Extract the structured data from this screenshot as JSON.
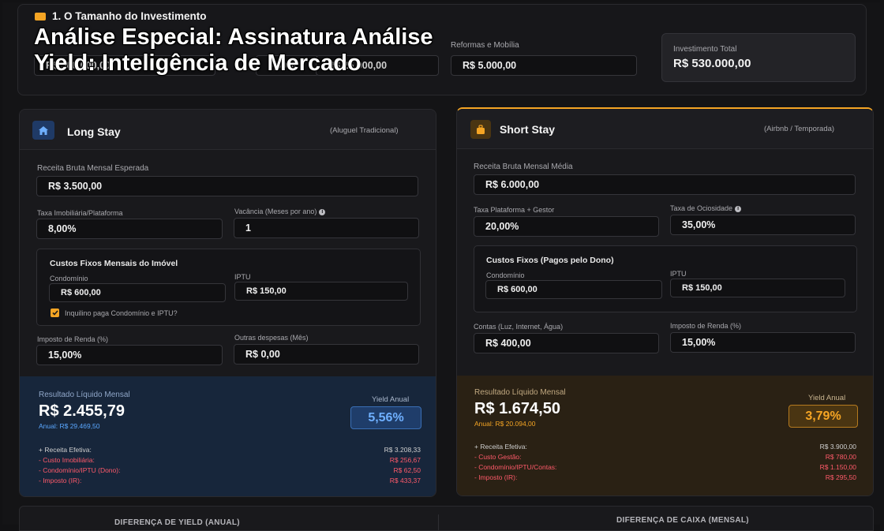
{
  "overlay": {
    "title": "Análise Especial: Assinatura Análise Yield: Inteligência de Mercado"
  },
  "investment": {
    "heading": "1. O Tamanho do Investimento",
    "property_value": "R$ 500.000,00",
    "fee_percent": "5,00%",
    "fee_value": "R$ 25.000,00",
    "reforms_label": "Reformas e Mobília",
    "reforms_value": "R$ 5.000,00",
    "total_label": "Investimento Total",
    "total_value": "R$ 530.000,00"
  },
  "long_stay": {
    "title": "Long Stay",
    "subtitle": "(Aluguel Tradicional)",
    "revenue_label": "Receita Bruta Mensal Esperada",
    "revenue_value": "R$ 3.500,00",
    "fee_label": "Taxa Imobiliária/Plataforma",
    "fee_value": "8,00%",
    "vacancy_label": "Vacância (Meses por ano)",
    "vacancy_value": "1",
    "fixed_costs_title": "Custos Fixos Mensais do Imóvel",
    "condo_label": "Condomínio",
    "condo_value": "R$ 600,00",
    "iptu_label": "IPTU",
    "iptu_value": "R$ 150,00",
    "tenant_pays_label": "Inquilino paga Condomínio e IPTU?",
    "tax_label": "Imposto de Renda (%)",
    "tax_value": "15,00%",
    "other_label": "Outras despesas (Mês)",
    "other_value": "R$ 0,00",
    "result_label": "Resultado Líquido Mensal",
    "result_value": "R$ 2.455,79",
    "annual_text": "Anual: R$ 29.469,50",
    "yield_label": "Yield Anual",
    "yield_value": "5,56%",
    "breakdown": [
      {
        "label": "+ Receita Efetiva:",
        "value": "R$ 3.208,33"
      },
      {
        "label": "- Custo Imobiliária:",
        "value": "R$ 256,67"
      },
      {
        "label": "- Condomínio/IPTU (Dono):",
        "value": "R$ 62,50"
      },
      {
        "label": "- Imposto (IR):",
        "value": "R$ 433,37"
      }
    ]
  },
  "short_stay": {
    "title": "Short Stay",
    "subtitle": "(Airbnb / Temporada)",
    "revenue_label": "Receita Bruta Mensal Média",
    "revenue_value": "R$ 6.000,00",
    "fee_label": "Taxa Plataforma + Gestor",
    "fee_value": "20,00%",
    "idle_label": "Taxa de Ociosidade",
    "idle_value": "35,00%",
    "fixed_costs_title": "Custos Fixos (Pagos pelo Dono)",
    "condo_label": "Condomínio",
    "condo_value": "R$ 600,00",
    "iptu_label": "IPTU",
    "iptu_value": "R$ 150,00",
    "bills_label": "Contas (Luz, Internet, Água)",
    "bills_value": "R$ 400,00",
    "tax_label": "Imposto de Renda (%)",
    "tax_value": "15,00%",
    "result_label": "Resultado Líquido Mensal",
    "result_value": "R$ 1.674,50",
    "annual_text": "Anual: R$ 20.094,00",
    "yield_label": "Yield Anual",
    "yield_value": "3,79%",
    "breakdown": [
      {
        "label": "+ Receita Efetiva:",
        "value": "R$ 3.900,00"
      },
      {
        "label": "- Custo Gestão:",
        "value": "R$ 780,00"
      },
      {
        "label": "- Condomínio/IPTU/Contas:",
        "value": "R$ 1.150,00"
      },
      {
        "label": "- Imposto (IR):",
        "value": "R$ 295,50"
      }
    ]
  },
  "footer": {
    "yield_diff": "DIFERENÇA DE YIELD (ANUAL)",
    "cash_diff": "DIFERENÇA DE CAIXA (MENSAL)"
  },
  "colors": {
    "blue_accent": "#5aa7ff",
    "orange_accent": "#f5a524",
    "negative": "#ff5a6a"
  }
}
